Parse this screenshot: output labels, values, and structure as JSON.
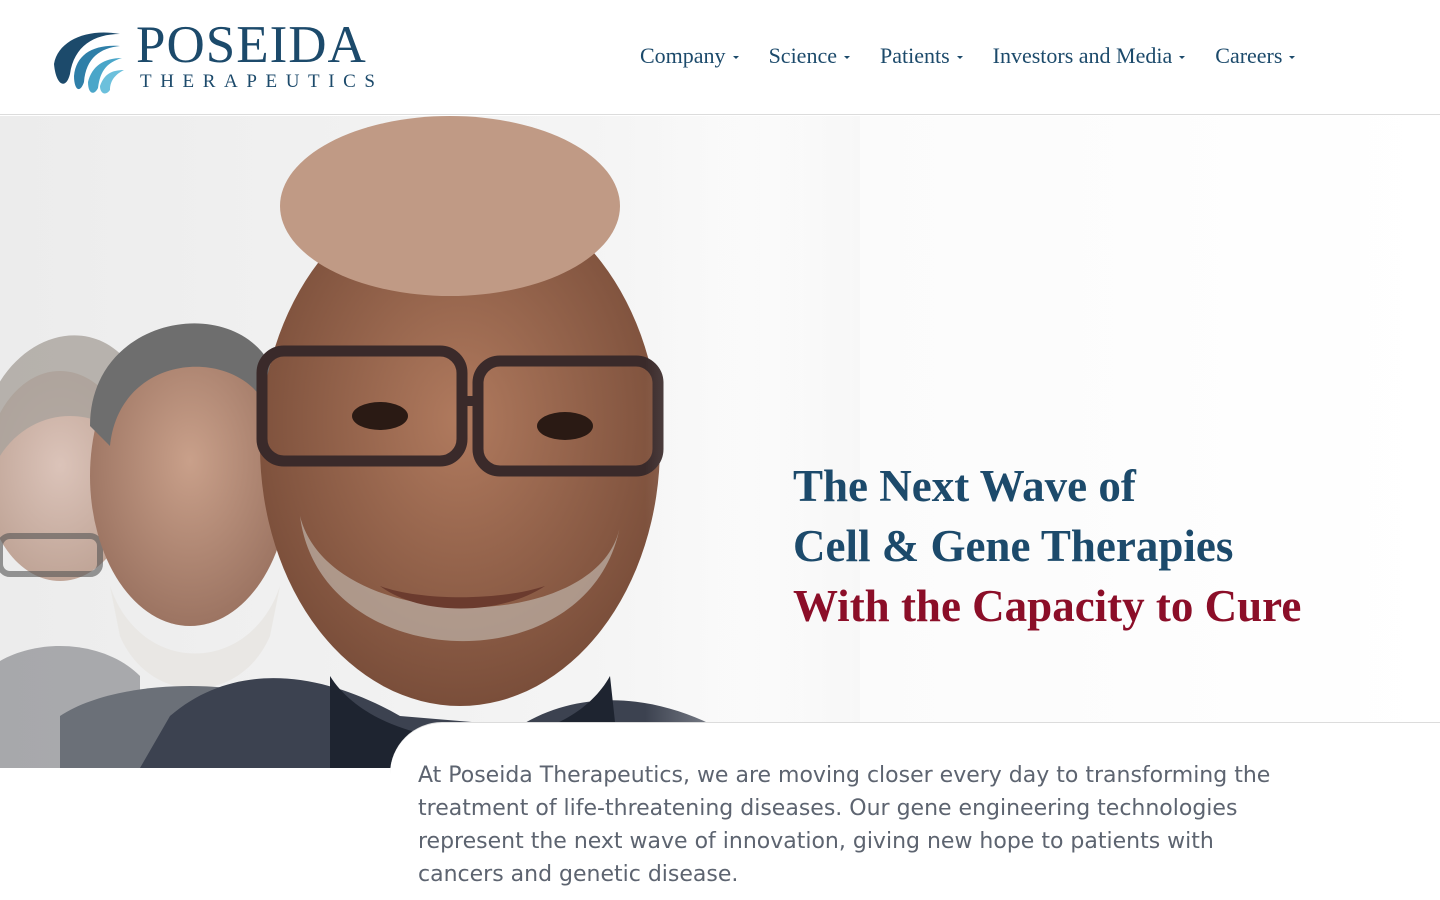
{
  "brand": {
    "name": "POSEIDA",
    "tagline": "THERAPEUTICS",
    "colors": {
      "primary": "#1c4a6b",
      "accent": "#8b0e28",
      "body_text": "#5d6470"
    }
  },
  "nav": {
    "items": [
      {
        "label": "Company"
      },
      {
        "label": "Science"
      },
      {
        "label": "Patients"
      },
      {
        "label": "Investors and Media"
      },
      {
        "label": "Careers"
      }
    ]
  },
  "hero": {
    "line1": "The Next Wave of",
    "line2": "Cell & Gene Therapies",
    "line3": "With the Capacity to Cure"
  },
  "intro": {
    "text": "At Poseida Therapeutics, we are moving closer every day to transforming the treatment of life-threatening diseases. Our gene engineering technologies represent the next wave of innovation, giving new hope to patients with cancers and genetic disease."
  }
}
